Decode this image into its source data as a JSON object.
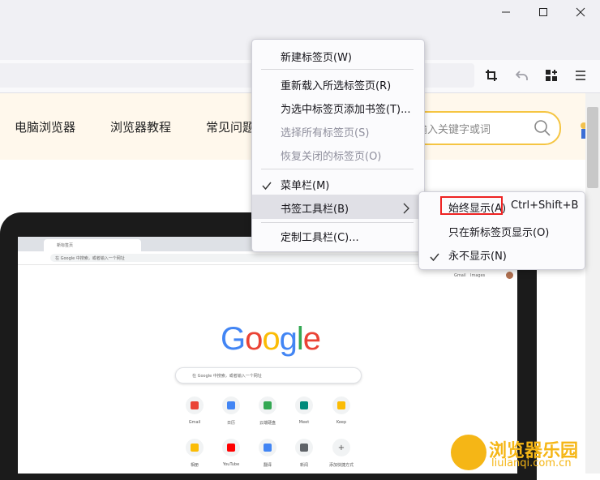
{
  "site_nav": [
    "电脑浏览器",
    "浏览器教程",
    "常见问题"
  ],
  "search": {
    "placeholder": "输入关键字或词"
  },
  "context_menu": {
    "items": [
      {
        "label": "新建标签页(W)",
        "disabled": false
      },
      {
        "label": "重新载入所选标签页(R)",
        "disabled": false
      },
      {
        "label": "为选中标签页添加书签(T)...",
        "disabled": false
      },
      {
        "label": "选择所有标签页(S)",
        "disabled": true
      },
      {
        "label": "恢复关闭的标签页(O)",
        "disabled": true
      },
      {
        "label": "菜单栏(M)",
        "checked": true
      },
      {
        "label": "书签工具栏(B)",
        "has_submenu": true,
        "highlighted": true
      },
      {
        "label": "定制工具栏(C)...",
        "disabled": false
      }
    ]
  },
  "submenu": {
    "items": [
      {
        "label": "始终显示(A)",
        "shortcut": "Ctrl+Shift+B",
        "boxed": true
      },
      {
        "label": "只在新标签页显示(O)"
      },
      {
        "label": "永不显示(N)",
        "checked": true
      }
    ]
  },
  "laptop_screen": {
    "logo": [
      "G",
      "o",
      "o",
      "g",
      "l",
      "e"
    ],
    "logo_colors": [
      "#4285f4",
      "#ea4335",
      "#fbbc05",
      "#4285f4",
      "#34a853",
      "#ea4335"
    ],
    "tab_title": "新标签页",
    "omnibox": "在 Google 中搜索，或者输入一个网址",
    "search_placeholder": "在 Google 中搜索，或者输入一个网址",
    "top_links": [
      "Gmail",
      "Images"
    ],
    "shortcuts_row1": [
      "Gmail",
      "日历",
      "云端硬盘",
      "Meet",
      "Keep"
    ],
    "shortcuts_row2": [
      "相册",
      "YouTube",
      "翻译",
      "新闻",
      "添加快捷方式"
    ]
  },
  "watermark": {
    "title": "浏览器乐园",
    "url": "liulanqi.com.cn"
  },
  "icons": [
    "minimize-icon",
    "maximize-icon",
    "close-icon",
    "crop-icon",
    "undo-icon",
    "extensions-icon",
    "menu-icon",
    "search-icon",
    "check-icon",
    "chevron-right-icon"
  ]
}
